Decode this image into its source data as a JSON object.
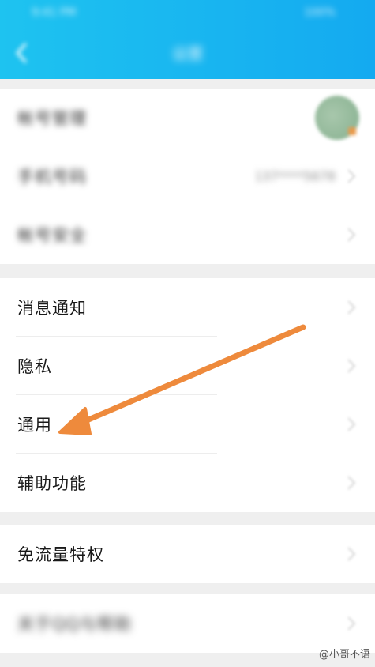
{
  "header": {
    "status_left": "9:41 PM",
    "status_right": "100%",
    "title": "设置"
  },
  "account_group": {
    "items": [
      {
        "label": "帐号管理"
      },
      {
        "label": "手机号码",
        "value": "137****5678"
      },
      {
        "label": "帐号安全"
      }
    ]
  },
  "settings_group": {
    "items": [
      {
        "label": "消息通知"
      },
      {
        "label": "隐私"
      },
      {
        "label": "通用"
      },
      {
        "label": "辅助功能"
      }
    ]
  },
  "traffic_group": {
    "items": [
      {
        "label": "免流量特权"
      }
    ]
  },
  "about_group": {
    "items": [
      {
        "label": "关于QQ与帮助"
      }
    ]
  },
  "watermark": "@小哥不语",
  "colors": {
    "header_gradient_start": "#1ec3f0",
    "header_gradient_end": "#14aaf0",
    "annotation_arrow": "#ee8a3c"
  }
}
